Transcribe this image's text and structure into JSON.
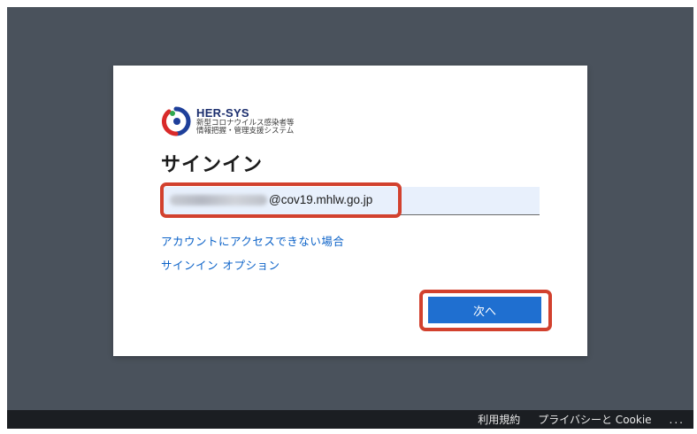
{
  "signin": {
    "logo": {
      "brand": "HER-SYS",
      "subtitle_line1": "新型コロナウイルス感染者等",
      "subtitle_line2": "情報把握・管理支援システム"
    },
    "title": "サインイン",
    "email": {
      "visible_domain": "@cov19.mhlw.go.jp",
      "local_part_blurred": true
    },
    "links": {
      "account_access": "アカウントにアクセスできない場合",
      "signin_options": "サインイン オプション"
    },
    "next_button_label": "次へ"
  },
  "footer": {
    "terms": "利用規約",
    "privacy": "プライバシーと Cookie",
    "more": "..."
  },
  "colors": {
    "background": "#4a525c",
    "footer": "#1b1e22",
    "accent_button": "#1f6fd0",
    "link": "#0b62c8",
    "highlight": "#d2412e",
    "field_bg": "#e8f0fc"
  }
}
